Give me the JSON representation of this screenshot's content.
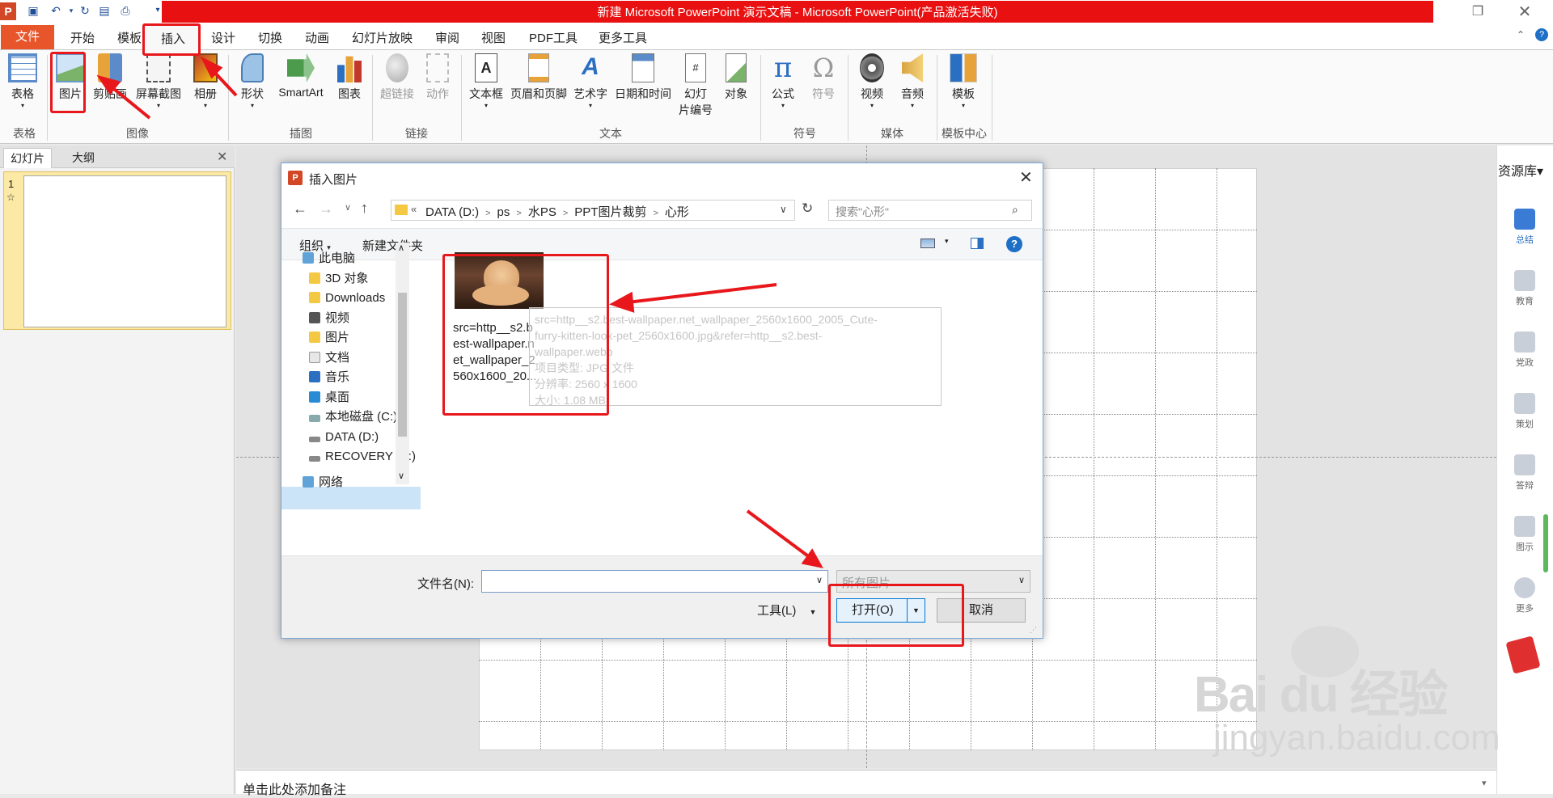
{
  "window": {
    "title": "新建 Microsoft PowerPoint 演示文稿 - Microsoft PowerPoint(产品激活失败)",
    "app_icon": "P"
  },
  "ribbon_tabs": [
    "文件",
    "开始",
    "模板",
    "插入",
    "设计",
    "切换",
    "动画",
    "幻灯片放映",
    "审阅",
    "视图",
    "PDF工具",
    "更多工具"
  ],
  "ribbon": {
    "buttons": {
      "table": "表格",
      "picture": "图片",
      "clipart": "剪贴画",
      "screenshot": "屏幕截图",
      "album": "相册",
      "shapes": "形状",
      "smartart": "SmartArt",
      "chart": "图表",
      "hyperlink": "超链接",
      "action": "动作",
      "textbox": "文本框",
      "header_footer": "页眉和页脚",
      "wordart": "艺术字",
      "datetime": "日期和时间",
      "slide_number_1": "幻灯",
      "slide_number_2": "片编号",
      "object": "对象",
      "equation": "公式",
      "symbol": "符号",
      "video": "视频",
      "audio": "音频",
      "template": "模板"
    },
    "groups": {
      "tables": "表格",
      "images": "图像",
      "illustrations": "插图",
      "links": "链接",
      "text": "文本",
      "symbols": "符号",
      "media": "媒体",
      "template_center": "模板中心"
    }
  },
  "left_pane": {
    "tab_slides": "幻灯片",
    "tab_outline": "大纲",
    "slide_number": "1",
    "slide_star": "☆"
  },
  "notes_placeholder": "单击此处添加备注",
  "right_panel": {
    "header": "资源库",
    "items": [
      "总结",
      "教育",
      "党政",
      "策划",
      "答辩",
      "图示",
      "更多"
    ]
  },
  "dialog": {
    "title": "插入图片",
    "path": [
      "DATA (D:)",
      "ps",
      "水PS",
      "PPT图片裁剪",
      "心形"
    ],
    "search_placeholder": "搜索\"心形\"",
    "toolbar": {
      "organize": "组织",
      "new_folder": "新建文件夹"
    },
    "nav": [
      "此电脑",
      "3D 对象",
      "Downloads",
      "视频",
      "图片",
      "文档",
      "音乐",
      "桌面",
      "本地磁盘 (C:)",
      "DATA (D:)",
      "RECOVERY (E:)",
      "网络"
    ],
    "file": {
      "name_lines": [
        "src=http__s2.b",
        "est-wallpaper.n",
        "et_wallpaper_2",
        "560x1600_20..."
      ]
    },
    "tooltip_lines": [
      "src=http__s2.best-wallpaper.net_wallpaper_2560x1600_2005_Cute-",
      "furry-kitten-look-pet_2560x1600.jpg&refer=http__s2.best-",
      "wallpaper.webp",
      "项目类型: JPG 文件",
      "分辨率: 2560 x 1600",
      "大小: 1.08 MB"
    ],
    "filename_label": "文件名(N):",
    "filename_value": "",
    "filetype": "所有图片",
    "tools": "工具(L)",
    "open": "打开(O)",
    "cancel": "取消"
  },
  "watermark": {
    "brand": "Bai du 经验",
    "url": "jingyan.baidu.com"
  }
}
